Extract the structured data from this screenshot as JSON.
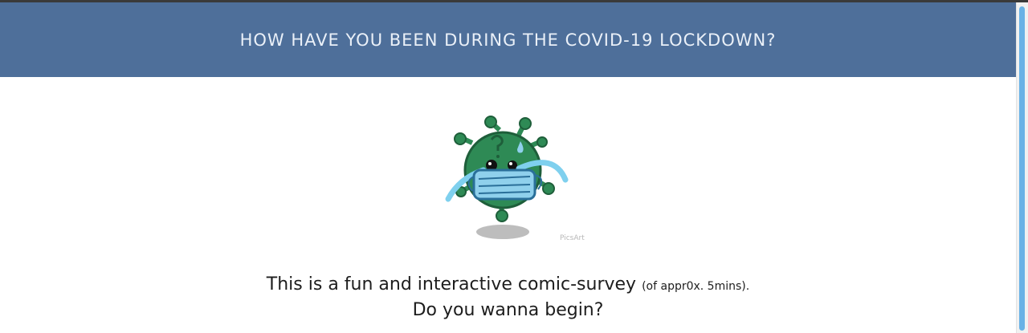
{
  "header": {
    "title": "HOW HAVE YOU BEEN DURING THE COVID-19 LOCKDOWN?"
  },
  "mascot": {
    "icon": "crying-virus-with-mask-icon",
    "watermark": "PicsArt"
  },
  "intro": {
    "line1_main": "This is a fun and interactive comic-survey",
    "line1_note": "(of appr0x. 5mins).",
    "line2": "Do you wanna begin?"
  },
  "colors": {
    "header_bg": "#4e6f9a",
    "scroll_thumb": "#6ab2e6",
    "virus_green": "#2e8a55",
    "mask_blue": "#8fd0ec",
    "tears": "#7fd0ee"
  }
}
